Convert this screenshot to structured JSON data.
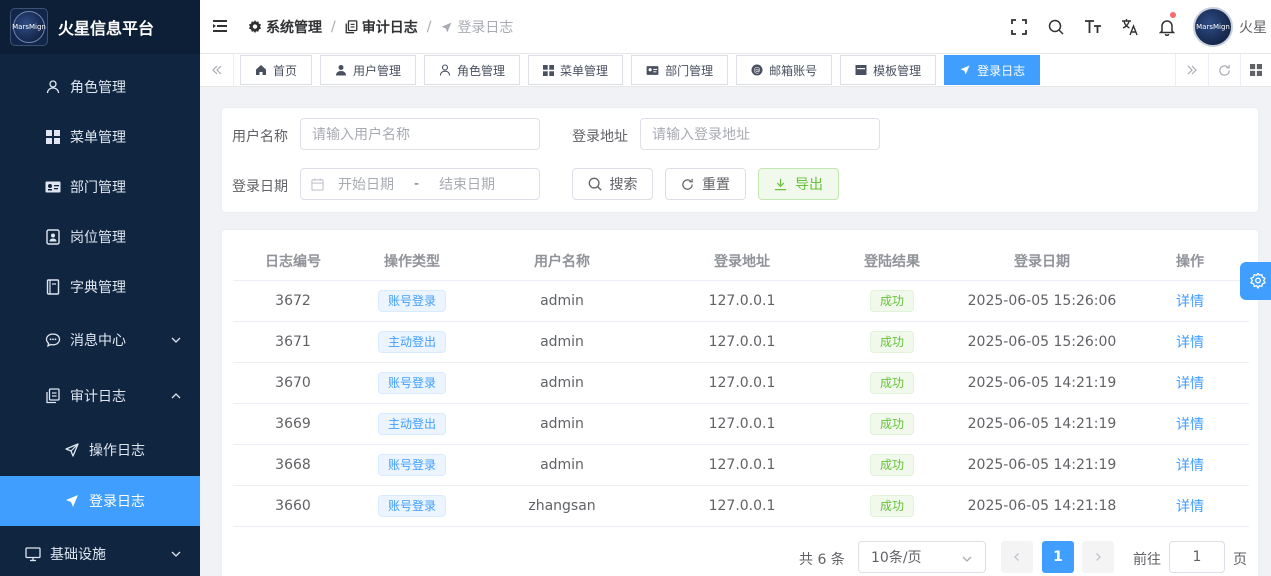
{
  "brand": {
    "title": "火星信息平台",
    "logo_text": "MarsMign"
  },
  "sidebar": {
    "items": [
      {
        "label": "角色管理",
        "icon": "user-icon"
      },
      {
        "label": "菜单管理",
        "icon": "grid-icon"
      },
      {
        "label": "部门管理",
        "icon": "id-card-icon"
      },
      {
        "label": "岗位管理",
        "icon": "badge-icon"
      },
      {
        "label": "字典管理",
        "icon": "book-icon"
      },
      {
        "label": "消息中心",
        "icon": "chat-icon"
      },
      {
        "label": "审计日志",
        "icon": "copy-icon"
      },
      {
        "label": "操作日志",
        "icon": "send-outline-icon"
      },
      {
        "label": "登录日志",
        "icon": "send-icon"
      },
      {
        "label": "基础设施",
        "icon": "monitor-icon"
      }
    ]
  },
  "header": {
    "breadcrumb": [
      "系统管理",
      "审计日志",
      "登录日志"
    ],
    "username": "火星",
    "avatar_text": "MarsMign"
  },
  "tabs": [
    {
      "label": "首页",
      "icon": "home-icon",
      "active": false
    },
    {
      "label": "用户管理",
      "icon": "user-icon",
      "active": false
    },
    {
      "label": "角色管理",
      "icon": "user-outline-icon",
      "active": false
    },
    {
      "label": "菜单管理",
      "icon": "grid-icon",
      "active": false
    },
    {
      "label": "部门管理",
      "icon": "id-card-icon",
      "active": false
    },
    {
      "label": "邮箱账号",
      "icon": "at-icon",
      "active": false
    },
    {
      "label": "模板管理",
      "icon": "template-icon",
      "active": false
    },
    {
      "label": "登录日志",
      "icon": "send-icon",
      "active": true
    }
  ],
  "search": {
    "username_label": "用户名称",
    "username_placeholder": "请输入用户名称",
    "address_label": "登录地址",
    "address_placeholder": "请输入登录地址",
    "date_label": "登录日期",
    "date_start": "开始日期",
    "date_sep": "-",
    "date_end": "结束日期",
    "search_btn": "搜索",
    "reset_btn": "重置",
    "export_btn": "导出"
  },
  "table": {
    "columns": [
      "日志编号",
      "操作类型",
      "用户名称",
      "登录地址",
      "登陆结果",
      "登录日期",
      "操作"
    ],
    "rows": [
      {
        "id": "3672",
        "type": "账号登录",
        "user": "admin",
        "addr": "127.0.0.1",
        "result": "成功",
        "date": "2025-06-05 15:26:06",
        "action": "详情"
      },
      {
        "id": "3671",
        "type": "主动登出",
        "user": "admin",
        "addr": "127.0.0.1",
        "result": "成功",
        "date": "2025-06-05 15:26:00",
        "action": "详情"
      },
      {
        "id": "3670",
        "type": "账号登录",
        "user": "admin",
        "addr": "127.0.0.1",
        "result": "成功",
        "date": "2025-06-05 14:21:19",
        "action": "详情"
      },
      {
        "id": "3669",
        "type": "主动登出",
        "user": "admin",
        "addr": "127.0.0.1",
        "result": "成功",
        "date": "2025-06-05 14:21:19",
        "action": "详情"
      },
      {
        "id": "3668",
        "type": "账号登录",
        "user": "admin",
        "addr": "127.0.0.1",
        "result": "成功",
        "date": "2025-06-05 14:21:19",
        "action": "详情"
      },
      {
        "id": "3660",
        "type": "账号登录",
        "user": "zhangsan",
        "addr": "127.0.0.1",
        "result": "成功",
        "date": "2025-06-05 14:21:18",
        "action": "详情"
      }
    ]
  },
  "pagination": {
    "total": "共 6 条",
    "page_size": "10条/页",
    "current": "1",
    "goto_label": "前往",
    "goto_value": "1",
    "page_suffix": "页"
  },
  "colors": {
    "sidebar_bg": "#0f2540",
    "accent": "#409eff",
    "success": "#67c23a"
  }
}
